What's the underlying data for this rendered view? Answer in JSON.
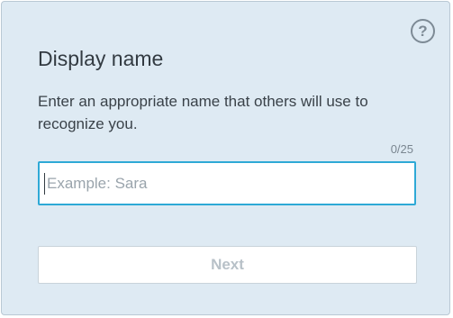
{
  "dialog": {
    "help_icon": "question-mark-circle-icon",
    "help_glyph": "?",
    "title": "Display name",
    "description": "Enter an appropriate name that others will use to recognize you.",
    "char_counter": "0/25",
    "name_field": {
      "value": "",
      "placeholder": "Example: Sara"
    },
    "next_label": "Next"
  },
  "colors": {
    "background": "#deeaf3",
    "input_focus_border": "#2ea9d6",
    "disabled_text": "#b8c1c8"
  }
}
